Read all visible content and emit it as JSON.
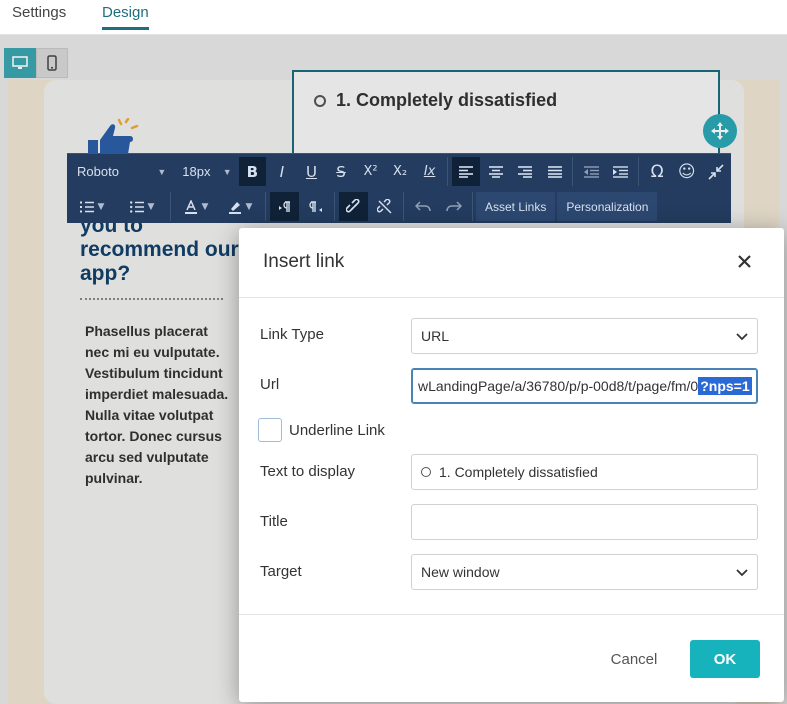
{
  "tabs": [
    {
      "label": "Settings"
    },
    {
      "label": "Design"
    }
  ],
  "device_toggle": {
    "desktop": "desktop-icon",
    "mobile": "mobile-icon",
    "active": "desktop"
  },
  "canvas": {
    "survey_option": "1.  Completely dissatisfied",
    "heading": "you to recommend our app?",
    "body": "Phasellus placerat nec mi eu vulputate. Vestibulum tincidunt imperdiet malesuada. Nulla vitae volutpat tortor. Donec cursus arcu sed vulputate pulvinar."
  },
  "toolbar": {
    "font_family": "Roboto",
    "font_size": "18px",
    "asset_links": "Asset Links",
    "personalization": "Personalization",
    "bold_glyph": "B",
    "italic_glyph": "I",
    "underline_glyph": "U",
    "strike_glyph": "S",
    "superscript_glyph": "X²",
    "subscript_glyph": "X₂",
    "clear_format_glyph": "Ix",
    "omega_glyph": "Ω",
    "emoji_glyph": "☺"
  },
  "dialog": {
    "title": "Insert link",
    "link_type_label": "Link Type",
    "link_type_value": "URL",
    "url_label": "Url",
    "url_value_prefix": "wLandingPage/a/36780/p/p-00d8/t/page/fm/0",
    "url_value_selected": "?nps=1",
    "underline_label": "Underline Link",
    "underline_checked": false,
    "text_display_label": "Text to display",
    "text_display_value": "1.  Completely dissatisfied",
    "title_label": "Title",
    "title_value": "",
    "target_label": "Target",
    "target_value": "New window",
    "cancel_label": "Cancel",
    "ok_label": "OK"
  },
  "colors": {
    "accent": "#17b3bd",
    "toolbar_bg": "#233c5f",
    "heading": "#12406b",
    "selection": "#2a6ad6"
  }
}
